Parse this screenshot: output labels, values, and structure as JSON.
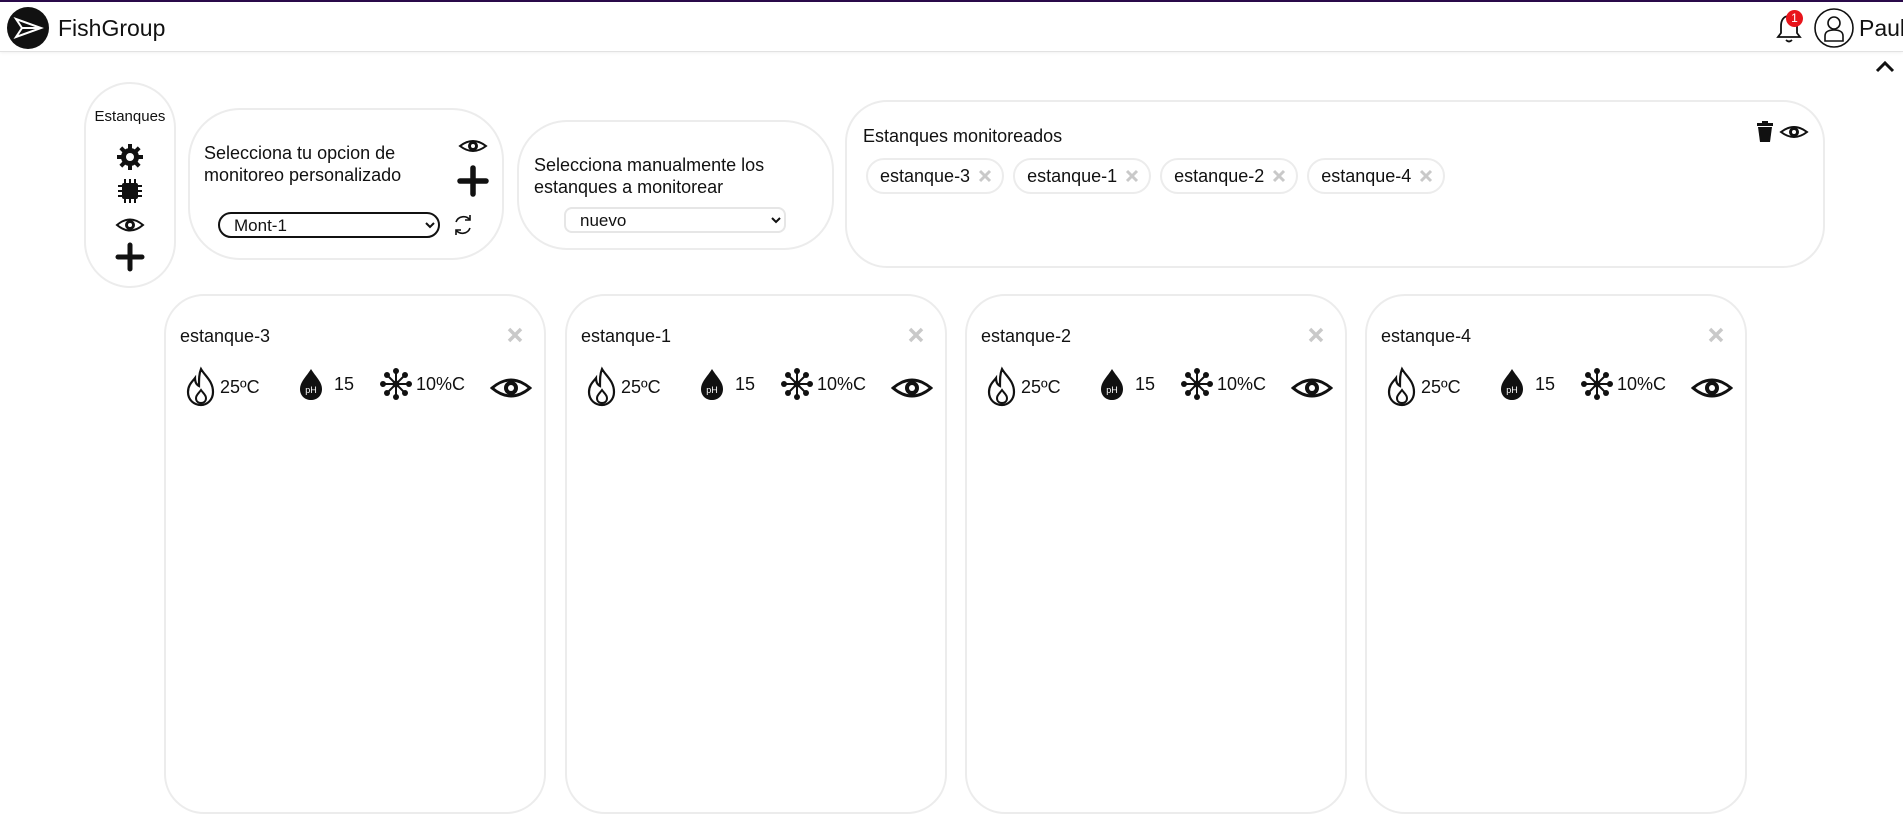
{
  "header": {
    "brand": "FishGroup",
    "notifications_count": "1",
    "username": "Paul"
  },
  "sidebar": {
    "title": "Estanques",
    "icons": [
      "settings-icon",
      "chip-icon",
      "eye-icon",
      "plus-icon"
    ]
  },
  "option_panel": {
    "text": "Selecciona tu opcion de monitoreo personalizado",
    "selected": "Mont-1"
  },
  "manual_panel": {
    "text": "Selecciona manualmente los estanques a monitorear",
    "selected": "nuevo"
  },
  "monitored": {
    "title": "Estanques monitoreados",
    "chips": [
      "estanque-3",
      "estanque-1",
      "estanque-2",
      "estanque-4"
    ]
  },
  "ponds": [
    {
      "name": "estanque-3",
      "temperature": "25ºC",
      "ph": "15",
      "oxygen": "10%C"
    },
    {
      "name": "estanque-1",
      "temperature": "25ºC",
      "ph": "15",
      "oxygen": "10%C"
    },
    {
      "name": "estanque-2",
      "temperature": "25ºC",
      "ph": "15",
      "oxygen": "10%C"
    },
    {
      "name": "estanque-4",
      "temperature": "25ºC",
      "ph": "15",
      "oxygen": "10%C"
    }
  ],
  "colors": {
    "accent_line": "#2a0a4a",
    "badge": "#e8141b",
    "border": "#ececec"
  }
}
